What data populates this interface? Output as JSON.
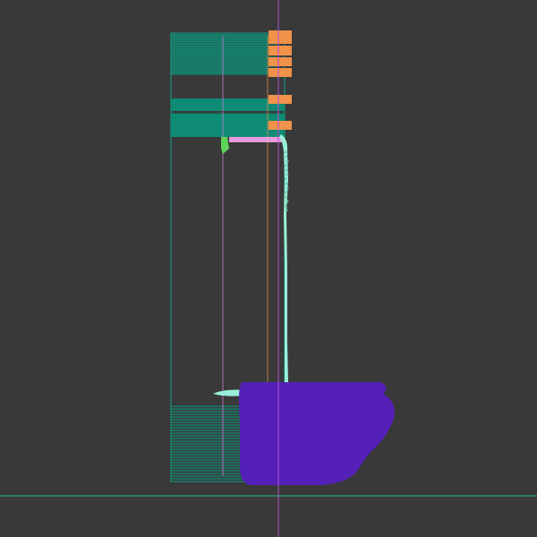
{
  "viewport": {
    "background": "#393939",
    "has_visible_text": false
  },
  "palette": {
    "teal_geometry": "#0f8f78",
    "teal_outline": "#10a386",
    "orange_geometry": "#f0924a",
    "pink_geometry": "#e69cdc",
    "green_geometry": "#5fd35a",
    "mint_stream": "#98f0d9",
    "purple_mass": "#5420b8",
    "axis_x": "#21c08c",
    "axis_y": "#b44fd6",
    "guide_inner": "#c77dd6",
    "guide_amber": "#f0924a"
  },
  "scene": {
    "axes": {
      "horizontal_axis": true,
      "vertical_axis": true
    },
    "teal_layer_bands": {
      "upper_band_lines": 18,
      "middle_band_lines": 14,
      "lower_band_lines": 28
    },
    "orange_blocks": {
      "count": 6
    },
    "pink_bar": {
      "present": true
    },
    "green_marker": {
      "present": true
    },
    "mint_stream": {
      "present": true
    },
    "purple_mass": {
      "present": true
    }
  }
}
